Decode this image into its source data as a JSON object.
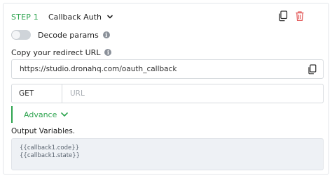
{
  "step": {
    "label": "STEP 1",
    "selected": "Callback Auth"
  },
  "decode": {
    "label": "Decode params",
    "enabled": false
  },
  "redirect": {
    "label": "Copy your redirect URL",
    "url": "https://studio.dronahq.com/oauth_callback"
  },
  "request": {
    "method": "GET",
    "url_placeholder": "URL"
  },
  "advance": {
    "label": "Advance"
  },
  "output": {
    "label": "Output Variables.",
    "variables": [
      "{{callback1.code}}",
      "{{callback1.state}}"
    ]
  },
  "colors": {
    "accent": "#2ea44f",
    "delete": "#e35d5d"
  }
}
